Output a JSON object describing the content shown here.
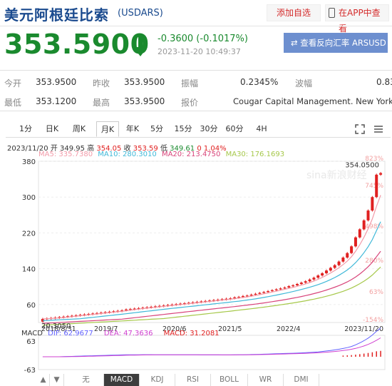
{
  "header": {
    "title": "美元阿根廷比索",
    "code": "(USDARS)",
    "fav_label": "添加自选",
    "app_label": "在APP中查看"
  },
  "quote": {
    "price": "353.5900",
    "change": "-0.3600 (-0.1017%)",
    "time": "2023-11-20 10:49:37",
    "invert_label": "查看反向汇率 ARSUSD",
    "trend": "down"
  },
  "stats": [
    {
      "label": "今开",
      "value": "353.9500"
    },
    {
      "label": "昨收",
      "value": "353.9500"
    },
    {
      "label": "振幅",
      "value": "0.2345%"
    },
    {
      "label": "波幅",
      "value": "0.83"
    },
    {
      "label": "最低",
      "value": "353.1200"
    },
    {
      "label": "最高",
      "value": "353.9500"
    },
    {
      "label": "报价",
      "value": "Cougar Capital Management. New York"
    }
  ],
  "tabs": [
    "1分",
    "日K",
    "周K",
    "月K",
    "年K",
    "5分",
    "15分",
    "30分",
    "60分",
    "4H"
  ],
  "active_tab": "月K",
  "ohlc": {
    "date": "2023/11/20",
    "open_label": "开",
    "open": "349.95",
    "high_label": "高",
    "high": "354.05",
    "close_label": "收",
    "close": "353.59",
    "low_label": "低",
    "low": "349.61",
    "pct": "0 1.04%"
  },
  "ma": {
    "ma5": "MA5: 335.7380",
    "ma10": "MA10: 280.3010",
    "ma20": "MA20: 213.4750",
    "ma30": "MA30: 176.1693"
  },
  "colors": {
    "up": "#e02020",
    "down": "#1a8a2e",
    "ma5": "#f29aa8",
    "ma10": "#3fb8d8",
    "ma20": "#d8447a",
    "ma30": "#a6c84a",
    "accent": "#1a4a8e"
  },
  "chart_data": {
    "type": "candlestick",
    "y_ticks": [
      "380",
      "300",
      "220",
      "140",
      "60"
    ],
    "y_range": [
      20,
      380
    ],
    "pct_ticks": [
      "823%",
      "745%",
      "498%",
      "280%",
      "63%",
      "-154%"
    ],
    "x_ticks": [
      "2018/8/31",
      "2019/7",
      "2020/6",
      "2021/5",
      "2022/4",
      "2023/11/20"
    ],
    "max_label": "354.0500",
    "min_label": "20.3050",
    "closes": [
      28,
      29,
      30,
      31,
      32,
      33,
      34,
      35,
      36,
      37,
      38,
      39,
      40,
      41,
      42,
      43,
      44,
      45,
      46,
      47,
      49,
      50,
      51,
      52,
      53,
      54,
      55,
      56,
      57,
      58,
      59,
      60,
      61,
      62,
      63,
      64,
      65,
      66,
      67,
      68,
      69,
      70,
      71,
      72,
      73,
      74,
      76,
      77,
      79,
      80,
      82,
      84,
      86,
      88,
      90,
      92,
      94,
      96,
      98,
      101,
      103,
      106,
      109,
      112,
      116,
      120,
      125,
      130,
      136,
      142,
      148,
      156,
      165,
      175,
      190,
      210,
      228,
      248,
      270,
      300,
      350,
      353.59
    ]
  },
  "macd": {
    "label": "MACD",
    "dif": "DIF: 62.9677",
    "dea": "DEA: 47.3636",
    "macd": "MACD: 31.2081",
    "ticks": [
      "63",
      "-63"
    ]
  },
  "indicators": [
    "无",
    "MACD",
    "KDJ",
    "RSI",
    "BOLL",
    "WR",
    "DMI"
  ],
  "active_indicator": "MACD"
}
